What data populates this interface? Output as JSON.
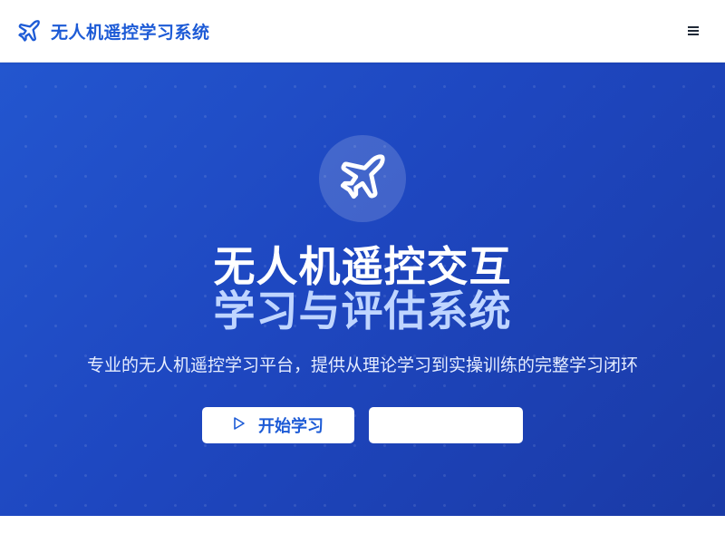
{
  "navbar": {
    "brand_icon": "plane-icon",
    "brand_title": "无人机遥控学习系统",
    "menu_icon": "hamburger-menu-icon",
    "brand_color": "#1d5bd6"
  },
  "hero": {
    "logo_icon": "plane-icon",
    "title_line1": "无人机遥控交互",
    "title_line2": "学习与评估系统",
    "subtitle": "专业的无人机遥控学习平台，提供从理论学习到实操训练的完整学习闭环",
    "primary_button": {
      "icon": "play-outline-icon",
      "label": "开始学习"
    },
    "secondary_button": {
      "label": ""
    },
    "gradient_colors": [
      "#2356cf",
      "#1a3aa6"
    ],
    "accent_text_color": "#bfd5ff"
  }
}
